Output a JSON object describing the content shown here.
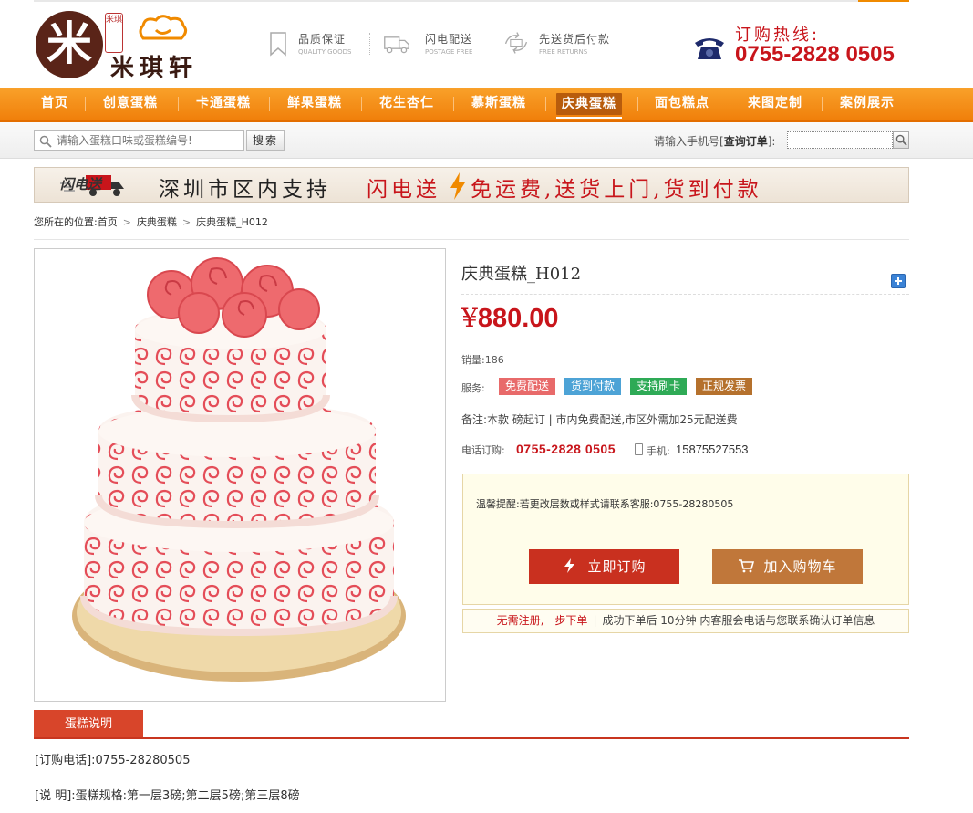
{
  "brand": {
    "name": "米琪轩",
    "seal": "米琪"
  },
  "features": [
    {
      "title": "品质保证",
      "subtitle": "QUALITY GOODS",
      "icon": "bookmark-icon"
    },
    {
      "title": "闪电配送",
      "subtitle": "POSTAGE FREE",
      "icon": "truck-icon"
    },
    {
      "title": "先送货后付款",
      "subtitle": "FREE RETURNS",
      "icon": "return-icon"
    }
  ],
  "hotline": {
    "label": "订购热线:",
    "number": "0755-2828 0505"
  },
  "nav": {
    "items": [
      "首页",
      "创意蛋糕",
      "卡通蛋糕",
      "鲜果蛋糕",
      "花生杏仁",
      "慕斯蛋糕",
      "庆典蛋糕",
      "面包糕点",
      "来图定制",
      "案例展示"
    ],
    "active_index": 6
  },
  "search": {
    "placeholder": "请输入蛋糕口味或蛋糕编号!",
    "button": "搜索",
    "query_prefix": "请输入手机号[",
    "query_bold": "查询订单",
    "query_suffix": "]:"
  },
  "banner": {
    "badge": "闪电送",
    "text1": "深圳市区内支持",
    "text2": "闪电送",
    "text3": "免运费,送货上门,货到付款"
  },
  "breadcrumb": {
    "prefix": "您所在的位置:",
    "items": [
      "首页",
      "庆典蛋糕",
      "庆典蛋糕_H012"
    ]
  },
  "product": {
    "title": "庆典蛋糕_H012",
    "currency": "¥",
    "price": "880.00",
    "sales_label": "销量:",
    "sales": "186",
    "services_label": "服务:",
    "services": [
      {
        "label": "免费配送",
        "color": "#e86a6a"
      },
      {
        "label": "货到付款",
        "color": "#4da3d6"
      },
      {
        "label": "支持刷卡",
        "color": "#2eaa56"
      },
      {
        "label": "正规发票",
        "color": "#b5712d"
      }
    ],
    "note": "备注:本款 磅起订 | 市内免费配送,市区外需加25元配送费",
    "tel_label": "电话订购:",
    "tel": "0755-2828 0505",
    "mobile_label": "手机:",
    "mobile": "15875527553"
  },
  "tipbox": {
    "tip": "温馨提醒:若更改层数或样式请联系客服:0755-28280505",
    "buy_label": "立即订购",
    "cart_label": "加入购物车"
  },
  "regbar": {
    "highlight": "无需注册,一步下单",
    "rest": "成功下单后 10分钟 内客服会电话与您联系确认订单信息"
  },
  "tabs": {
    "active": "蛋糕说明"
  },
  "description": {
    "line1": "[订购电话]:0755-28280505",
    "line2": "[说 明]:蛋糕规格:第一层3磅;第二层5磅;第三层8磅"
  },
  "colors": {
    "brand_orange": "#f08a00",
    "brand_red": "#c8151b",
    "cake_pink": "#e8505a"
  }
}
